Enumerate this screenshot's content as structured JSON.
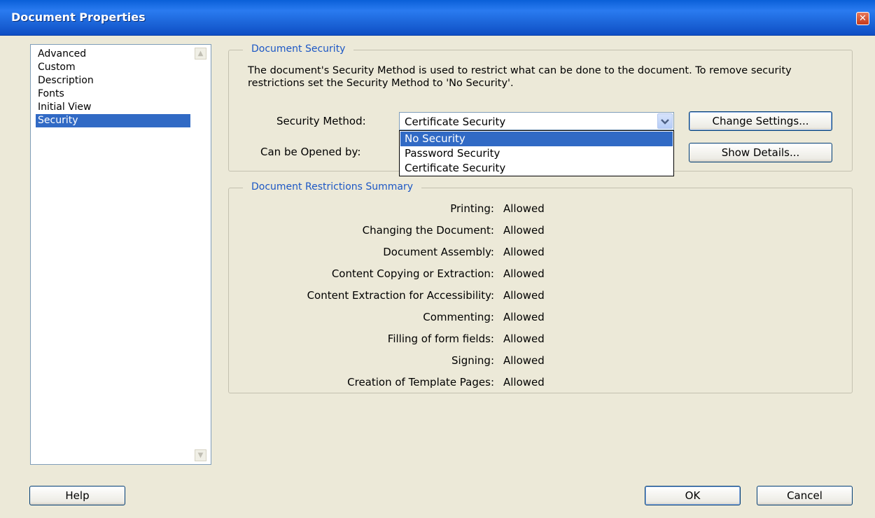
{
  "window": {
    "title": "Document Properties"
  },
  "sidebar": {
    "items": [
      {
        "label": "Advanced"
      },
      {
        "label": "Custom"
      },
      {
        "label": "Description"
      },
      {
        "label": "Fonts"
      },
      {
        "label": "Initial View"
      },
      {
        "label": "Security",
        "selected": true
      }
    ]
  },
  "security": {
    "group_title": "Document Security",
    "description": "The document's Security Method is used to restrict what can be done to the document. To remove security restrictions set the Security Method to 'No Security'.",
    "method_label": "Security Method:",
    "method_value": "Certificate Security",
    "options": [
      "No Security",
      "Password Security",
      "Certificate Security"
    ],
    "highlighted_option": "No Security",
    "opened_by_label": "Can be Opened by:",
    "change_settings_label": "Change Settings...",
    "show_details_label": "Show Details..."
  },
  "restrictions": {
    "group_title": "Document Restrictions Summary",
    "rows": [
      {
        "label": "Printing:",
        "value": "Allowed"
      },
      {
        "label": "Changing the Document:",
        "value": "Allowed"
      },
      {
        "label": "Document Assembly:",
        "value": "Allowed"
      },
      {
        "label": "Content Copying or Extraction:",
        "value": "Allowed"
      },
      {
        "label": "Content Extraction for Accessibility:",
        "value": "Allowed"
      },
      {
        "label": "Commenting:",
        "value": "Allowed"
      },
      {
        "label": "Filling of form fields:",
        "value": "Allowed"
      },
      {
        "label": "Signing:",
        "value": "Allowed"
      },
      {
        "label": "Creation of Template Pages:",
        "value": "Allowed"
      }
    ]
  },
  "footer": {
    "help_label": "Help",
    "ok_label": "OK",
    "cancel_label": "Cancel"
  },
  "icons": {
    "close": "close-icon",
    "combo_arrow": "chevron-down-icon",
    "scroll_up": "scroll-up-arrow-icon",
    "scroll_down": "scroll-down-arrow-icon"
  },
  "colors": {
    "titlebar": "#0a5fd8",
    "selection": "#316ac5",
    "group_title": "#1c57c5",
    "dialog_bg": "#ece9d8"
  }
}
